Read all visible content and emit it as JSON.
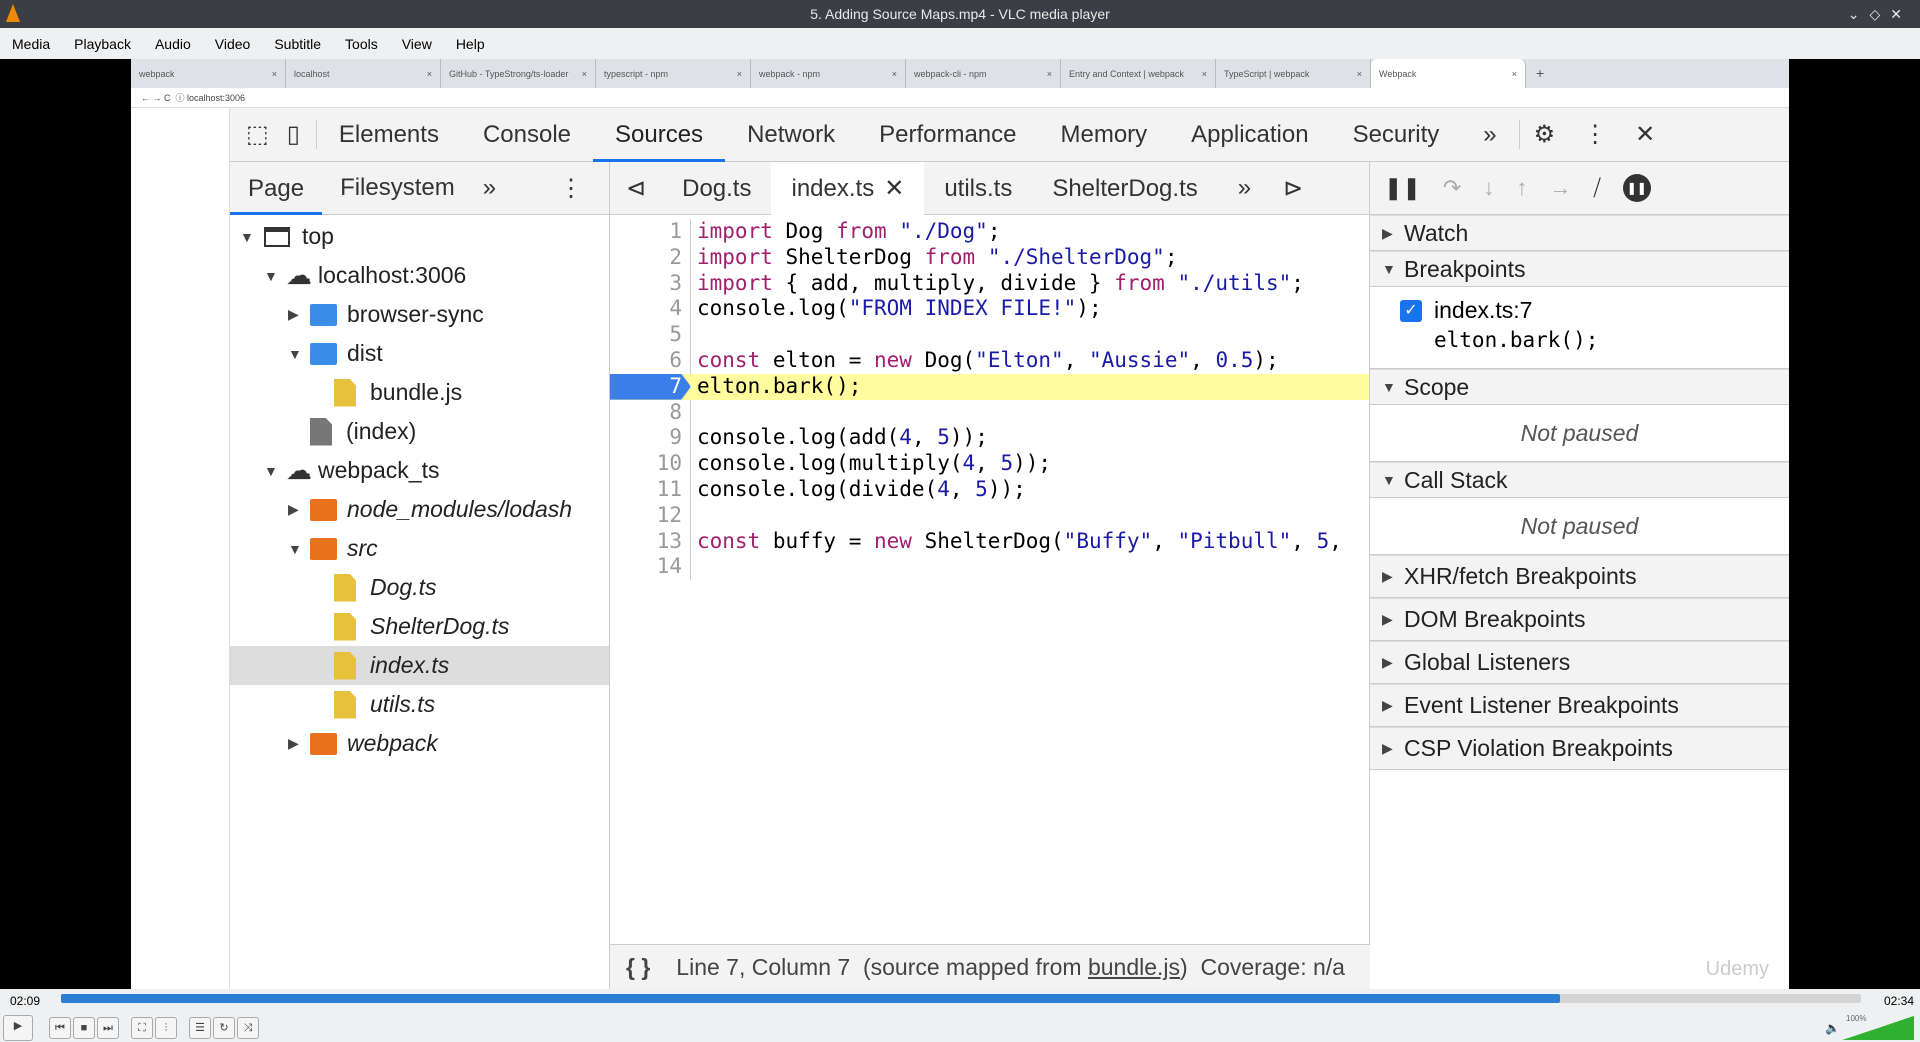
{
  "window": {
    "title": "5. Adding Source Maps.mp4 - VLC media player"
  },
  "menu": [
    "Media",
    "Playback",
    "Audio",
    "Video",
    "Subtitle",
    "Tools",
    "View",
    "Help"
  ],
  "browser": {
    "tabs": [
      "webpack",
      "localhost",
      "GitHub - TypeStrong/ts-loader",
      "typescript - npm",
      "webpack - npm",
      "webpack-cli - npm",
      "Entry and Context | webpack",
      "TypeScript | webpack",
      "Webpack"
    ],
    "address": "localhost:3006"
  },
  "devtools": {
    "tabs": [
      "Elements",
      "Console",
      "Sources",
      "Network",
      "Performance",
      "Memory",
      "Application",
      "Security"
    ],
    "selected_tab": "Sources",
    "nav_tabs": [
      "Page",
      "Filesystem"
    ],
    "tree": [
      {
        "label": "top",
        "depth": 0,
        "kind": "frame",
        "open": true
      },
      {
        "label": "localhost:3006",
        "depth": 1,
        "kind": "cloud",
        "open": true
      },
      {
        "label": "browser-sync",
        "depth": 2,
        "kind": "folder-blue",
        "open": false
      },
      {
        "label": "dist",
        "depth": 2,
        "kind": "folder-blue",
        "open": true
      },
      {
        "label": "bundle.js",
        "depth": 3,
        "kind": "file-yellow"
      },
      {
        "label": "(index)",
        "depth": 2,
        "kind": "file-gray"
      },
      {
        "label": "webpack_ts",
        "depth": 1,
        "kind": "cloud",
        "open": true
      },
      {
        "label": "node_modules/lodash",
        "depth": 2,
        "kind": "folder-orange",
        "open": false,
        "italic": true
      },
      {
        "label": "src",
        "depth": 2,
        "kind": "folder-orange",
        "open": true,
        "italic": true
      },
      {
        "label": "Dog.ts",
        "depth": 3,
        "kind": "file-yellow",
        "italic": true
      },
      {
        "label": "ShelterDog.ts",
        "depth": 3,
        "kind": "file-yellow",
        "italic": true
      },
      {
        "label": "index.ts",
        "depth": 3,
        "kind": "file-yellow",
        "italic": true,
        "selected": true
      },
      {
        "label": "utils.ts",
        "depth": 3,
        "kind": "file-yellow",
        "italic": true
      },
      {
        "label": "webpack",
        "depth": 2,
        "kind": "folder-orange",
        "open": false,
        "italic": true
      }
    ],
    "editor_tabs": [
      "Dog.ts",
      "index.ts",
      "utils.ts",
      "ShelterDog.ts"
    ],
    "active_editor_tab": "index.ts",
    "code": [
      "import Dog from \"./Dog\";",
      "import ShelterDog from \"./ShelterDog\";",
      "import { add, multiply, divide } from \"./utils\";",
      "console.log(\"FROM INDEX FILE!\");",
      "",
      "const elton = new Dog(\"Elton\", \"Aussie\", 0.5);",
      "elton.bark();",
      "",
      "console.log(add(4, 5));",
      "console.log(multiply(4, 5));",
      "console.log(divide(4, 5));",
      "",
      "const buffy = new ShelterDog(\"Buffy\", \"Pitbull\", 5,",
      ""
    ],
    "breakpoint_line": 7,
    "status": {
      "pre": "Line 7, Column 7  (source mapped from ",
      "link": "bundle.js",
      "post": ")  Coverage: n/a"
    },
    "right": {
      "watch": "Watch",
      "breakpoints": "Breakpoints",
      "bp_file": "index.ts:7",
      "bp_code": "elton.bark();",
      "scope": "Scope",
      "call_stack": "Call Stack",
      "not_paused": "Not paused",
      "collapsed": [
        "XHR/fetch Breakpoints",
        "DOM Breakpoints",
        "Global Listeners",
        "Event Listener Breakpoints",
        "CSP Violation Breakpoints"
      ]
    }
  },
  "watermark": "Udemy",
  "player": {
    "elapsed": "02:09",
    "total": "02:34",
    "progress": 0.833,
    "volume": "100%"
  },
  "colors": {
    "accent": "#2a7fd4",
    "highlight": "#fffc9e",
    "breakpoint": "#3b7de9"
  }
}
